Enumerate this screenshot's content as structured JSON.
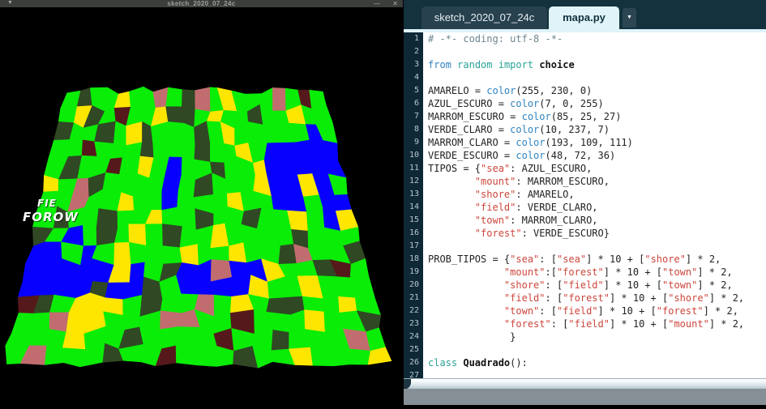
{
  "left_window": {
    "title": "sketch_2020_07_24c",
    "titlebar": {
      "menu_icon": "▼",
      "minimize_icon": "—",
      "close_icon": "✕"
    },
    "overlay_labels": [
      {
        "text": "FIE"
      },
      {
        "text": "FOROW"
      }
    ]
  },
  "terrain": {
    "types": {
      "f": {
        "name": "field",
        "hex": "#0AED07"
      },
      "F": {
        "name": "forest",
        "hex": "#304824"
      },
      "s": {
        "name": "sea",
        "hex": "#0700FF"
      },
      "h": {
        "name": "shore",
        "hex": "#FFE600"
      },
      "t": {
        "name": "town",
        "hex": "#C16D6F"
      },
      "m": {
        "name": "mount",
        "hex": "#55191B"
      }
    },
    "grid": [
      "fFffhfftfFtfhffftfmf",
      "fhFfmffhFFfhffFffhff",
      "FffFfhFfffFfhfffffsf",
      "ffmfffFfffFffhfsssss",
      "fFffmfhfsffFffhsssss",
      "hftFffffsfFfffhsshsf",
      "fftffhffsfffhffssfss",
      "fFffFffhffFffFffhfsh",
      "FfsfFfhfFffhffffFfff",
      "ssfsfhfffhffhffFtffF",
      "ssssshsfFsstsshffFmf",
      "ssssFssFfsssshffhfff",
      "mFfhhhfFfftfhfFFffhf",
      "ffthhfffttffmfffhffF",
      "fffhffFffffmffFffftf",
      "ftfffFffmfffFffhfffh"
    ]
  },
  "editor": {
    "tabs": [
      {
        "label": "sketch_2020_07_24c",
        "active": false
      },
      {
        "label": "mapa.py",
        "active": true
      }
    ],
    "tab_dropdown_icon": "▼",
    "line_count": 27,
    "lines": [
      [
        [
          "com",
          "# -*- coding: utf-8 -*-"
        ]
      ],
      [],
      [
        [
          "kw",
          "from"
        ],
        [
          "txt",
          " "
        ],
        [
          "kw2",
          "random"
        ],
        [
          "txt",
          " "
        ],
        [
          "kw2",
          "import"
        ],
        [
          "txt",
          " "
        ],
        [
          "fn",
          "choice"
        ]
      ],
      [],
      [
        [
          "txt",
          "AMARELO = "
        ],
        [
          "kw",
          "color"
        ],
        [
          "txt",
          "(255, 230, 0)"
        ]
      ],
      [
        [
          "txt",
          "AZUL_ESCURO = "
        ],
        [
          "kw",
          "color"
        ],
        [
          "txt",
          "(7, 0, 255)"
        ]
      ],
      [
        [
          "txt",
          "MARROM_ESCURO = "
        ],
        [
          "kw",
          "color"
        ],
        [
          "txt",
          "(85, 25, 27)"
        ]
      ],
      [
        [
          "txt",
          "VERDE_CLARO = "
        ],
        [
          "kw",
          "color"
        ],
        [
          "txt",
          "(10, 237, 7)"
        ]
      ],
      [
        [
          "txt",
          "MARROM_CLARO = "
        ],
        [
          "kw",
          "color"
        ],
        [
          "txt",
          "(193, 109, 111)"
        ]
      ],
      [
        [
          "txt",
          "VERDE_ESCURO = "
        ],
        [
          "kw",
          "color"
        ],
        [
          "txt",
          "(48, 72, 36)"
        ]
      ],
      [
        [
          "txt",
          "TIPOS = {"
        ],
        [
          "str",
          "\"sea\""
        ],
        [
          "txt",
          ": AZUL_ESCURO,"
        ]
      ],
      [
        [
          "txt",
          "        "
        ],
        [
          "str",
          "\"mount\""
        ],
        [
          "txt",
          ": MARROM_ESCURO,"
        ]
      ],
      [
        [
          "txt",
          "        "
        ],
        [
          "str",
          "\"shore\""
        ],
        [
          "txt",
          ": AMARELO,"
        ]
      ],
      [
        [
          "txt",
          "        "
        ],
        [
          "str",
          "\"field\""
        ],
        [
          "txt",
          ": VERDE_CLARO,"
        ]
      ],
      [
        [
          "txt",
          "        "
        ],
        [
          "str",
          "\"town\""
        ],
        [
          "txt",
          ": MARROM_CLARO,"
        ]
      ],
      [
        [
          "txt",
          "        "
        ],
        [
          "str",
          "\"forest\""
        ],
        [
          "txt",
          ": VERDE_ESCURO}"
        ]
      ],
      [],
      [
        [
          "txt",
          "PROB_TIPOS = {"
        ],
        [
          "str",
          "\"sea\""
        ],
        [
          "txt",
          ": ["
        ],
        [
          "str",
          "\"sea\""
        ],
        [
          "txt",
          "] * 10 + ["
        ],
        [
          "str",
          "\"shore\""
        ],
        [
          "txt",
          "] * 2,"
        ]
      ],
      [
        [
          "txt",
          "             "
        ],
        [
          "str",
          "\"mount\""
        ],
        [
          "txt",
          ":["
        ],
        [
          "str",
          "\"forest\""
        ],
        [
          "txt",
          "] * 10 + ["
        ],
        [
          "str",
          "\"town\""
        ],
        [
          "txt",
          "] * 2,"
        ]
      ],
      [
        [
          "txt",
          "             "
        ],
        [
          "str",
          "\"shore\""
        ],
        [
          "txt",
          ": ["
        ],
        [
          "str",
          "\"field\""
        ],
        [
          "txt",
          "] * 10 + ["
        ],
        [
          "str",
          "\"town\""
        ],
        [
          "txt",
          "] * 2,"
        ]
      ],
      [
        [
          "txt",
          "             "
        ],
        [
          "str",
          "\"field\""
        ],
        [
          "txt",
          ": ["
        ],
        [
          "str",
          "\"forest\""
        ],
        [
          "txt",
          "] * 10 + ["
        ],
        [
          "str",
          "\"shore\""
        ],
        [
          "txt",
          "] * 2,"
        ]
      ],
      [
        [
          "txt",
          "             "
        ],
        [
          "str",
          "\"town\""
        ],
        [
          "txt",
          ": ["
        ],
        [
          "str",
          "\"field\""
        ],
        [
          "txt",
          "] * 10 + ["
        ],
        [
          "str",
          "\"forest\""
        ],
        [
          "txt",
          "] * 2,"
        ]
      ],
      [
        [
          "txt",
          "             "
        ],
        [
          "str",
          "\"forest\""
        ],
        [
          "txt",
          ": ["
        ],
        [
          "str",
          "\"field\""
        ],
        [
          "txt",
          "] * 10 + ["
        ],
        [
          "str",
          "\"mount\""
        ],
        [
          "txt",
          "] * 2,"
        ]
      ],
      [
        [
          "txt",
          "              }"
        ]
      ],
      [],
      [
        [
          "kw2",
          "class"
        ],
        [
          "txt",
          " "
        ],
        [
          "fn",
          "Quadrado"
        ],
        [
          "txt",
          "():"
        ]
      ],
      []
    ]
  },
  "colors": {
    "tab_bar": "#14313e",
    "active_tab": "#dff3f8",
    "inactive_tab": "#27414f",
    "gutter": "#0e2836",
    "string_red": "#cd463c",
    "keyword_blue": "#2f83c0",
    "keyword_teal": "#2aa398",
    "comment_gray": "#6e8691",
    "console_gray": "#868f96",
    "sketch_titlebar": "#3b3e3b"
  }
}
